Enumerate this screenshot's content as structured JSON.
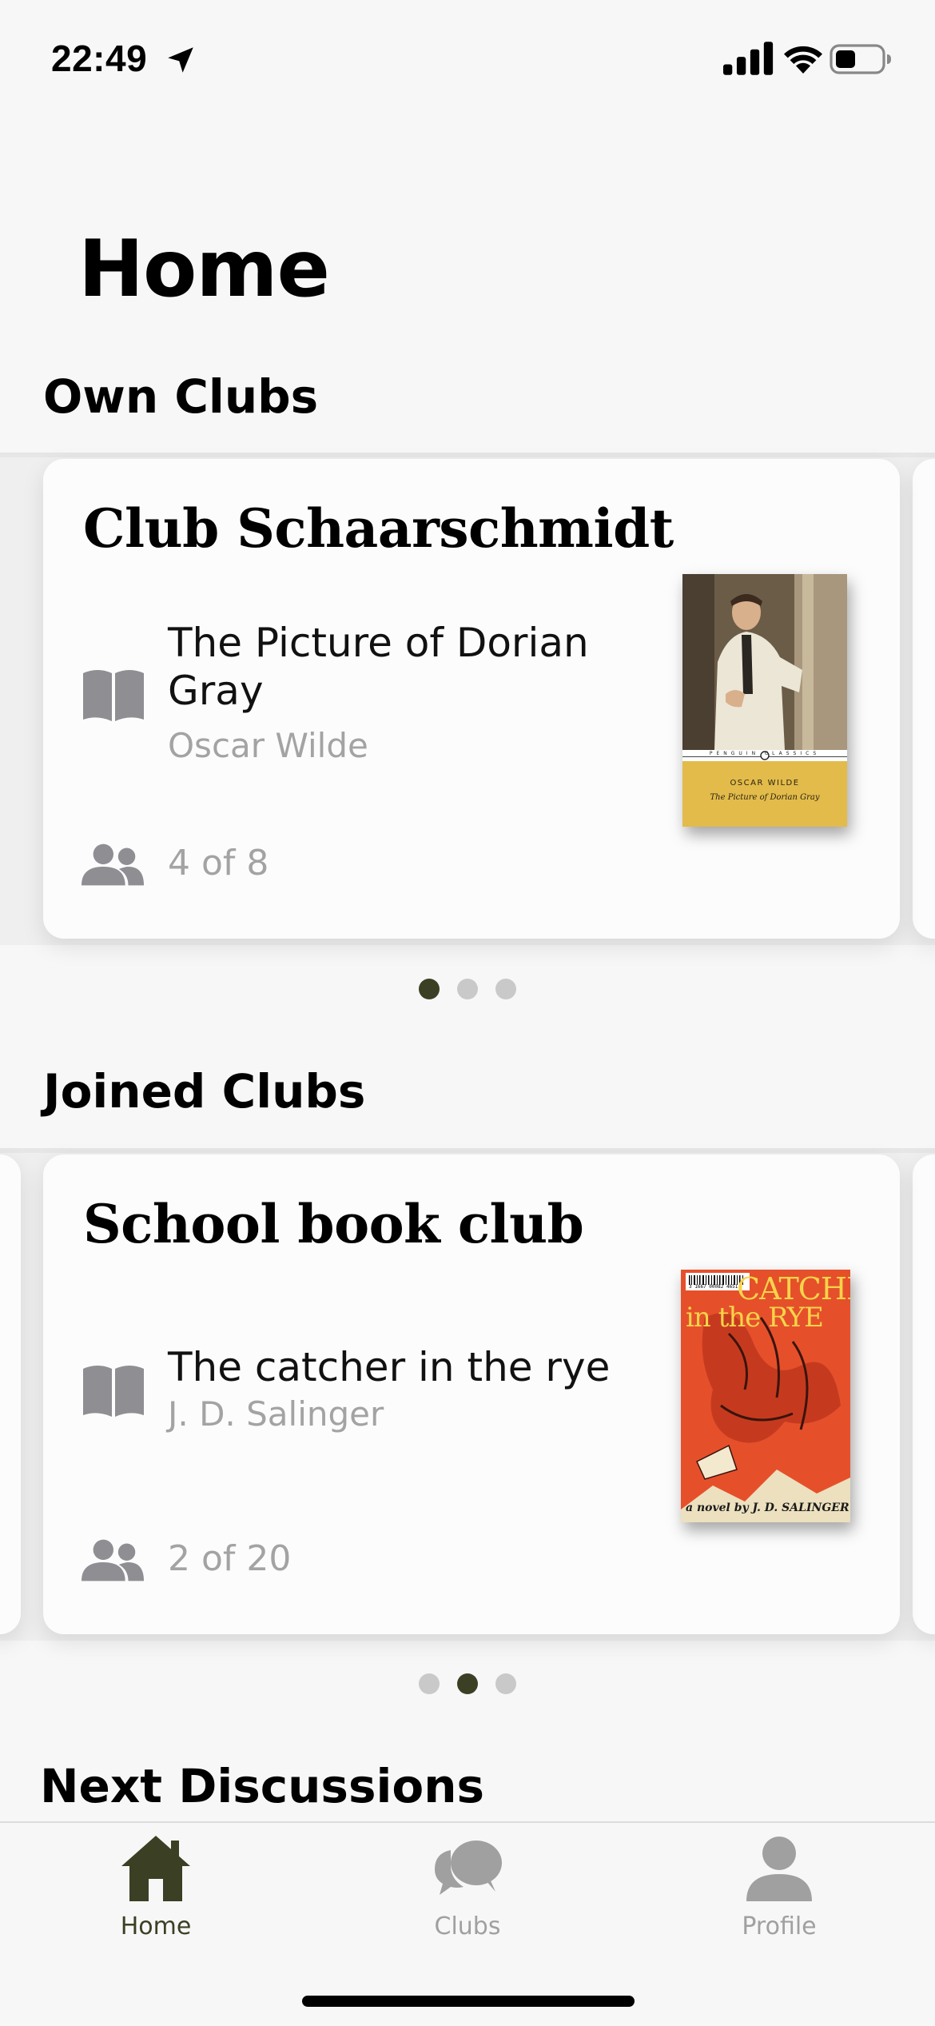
{
  "status_bar": {
    "time": "22:49",
    "icons": [
      "location-arrow-icon",
      "signal-icon",
      "wifi-icon",
      "battery-icon"
    ]
  },
  "page": {
    "title": "Home"
  },
  "sections": {
    "own_clubs": "Own Clubs",
    "joined_clubs": "Joined Clubs",
    "next_discussions": "Next Discussions"
  },
  "own_club_card": {
    "club_name": "Club Schaarschmidt",
    "book_title": "The Picture of Dorian Gray",
    "book_author": "Oscar Wilde",
    "members": "4 of 8",
    "cover": {
      "author": "OSCAR WILDE",
      "title": "The Picture of Dorian Gray",
      "publisher": "PENGUIN CLASSICS",
      "band_color": "#e2bb4b"
    },
    "carousel": {
      "count": 3,
      "active_index": 0
    }
  },
  "joined_club_card": {
    "club_name": "School book club",
    "book_title": "The catcher in the rye",
    "book_author": "J. D. Salinger",
    "members": "2 of 20",
    "cover": {
      "title_line1": "CATCHER",
      "title_line2": "in the RYE",
      "byline": "a novel by J. D. SALINGER",
      "barcode_number": "3 1667 00082 4651",
      "color": "#e5502b"
    },
    "carousel": {
      "count": 3,
      "active_index": 1
    }
  },
  "tab_bar": {
    "tabs": [
      {
        "label": "Home",
        "icon": "house-icon",
        "active": true
      },
      {
        "label": "Clubs",
        "icon": "chat-bubbles-icon",
        "active": false
      },
      {
        "label": "Profile",
        "icon": "person-icon",
        "active": false
      }
    ]
  },
  "colors": {
    "accent": "#3b4024",
    "inactive": "#a0a0a0",
    "background": "#f7f7f7",
    "card": "#fcfcfc"
  }
}
